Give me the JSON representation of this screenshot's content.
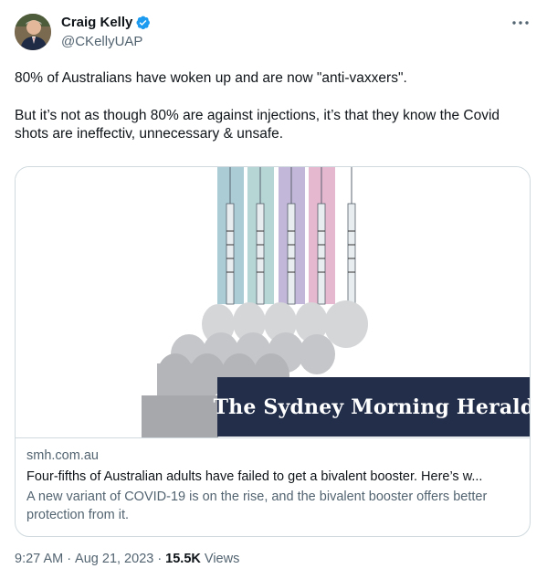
{
  "author": {
    "name": "Craig Kelly",
    "handle": "@CKellyUAP",
    "verified": true,
    "verified_color": "#1d9bf0"
  },
  "tweet": {
    "paragraph_1": "80% of Australians have woken up and are now \"anti-vaxxers\".",
    "paragraph_2": "But it’s not as though 80% are against injections, it’s that they know the Covid shots are ineffectiv, unnecessary & unsafe."
  },
  "card": {
    "masthead": "The Sydney Morning Herald",
    "domain": "smh.com.au",
    "title": "Four-fifths of Australian adults have failed to get a bivalent booster. Here’s w...",
    "description": "A new variant of COVID-19 is on the rise, and the bivalent booster offers better protection from it.",
    "syringe_colors": [
      "#9cc3cc",
      "#a9cfcf",
      "#b7a9d2",
      "#e2abc8",
      "#ffffff"
    ],
    "masthead_color": "#222e4a"
  },
  "meta": {
    "time": "9:27 AM",
    "dot_1": "·",
    "date": "Aug 21, 2023",
    "dot_2": "·",
    "views_count": "15.5K",
    "views_label": "Views"
  },
  "icons": {
    "more": "more-horizontal-icon",
    "verified": "verified-badge-icon"
  }
}
